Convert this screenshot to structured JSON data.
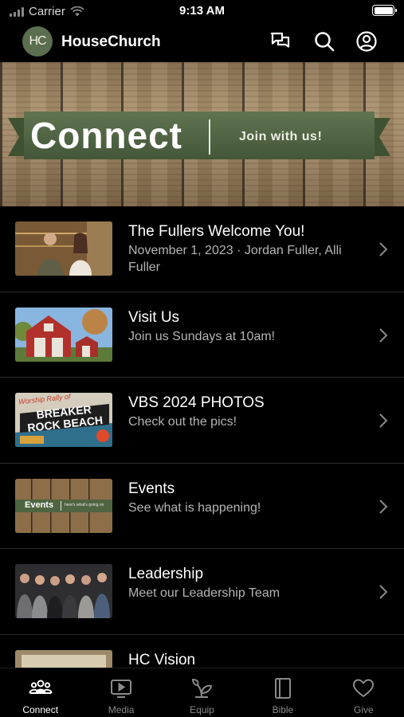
{
  "status_bar": {
    "carrier": "Carrier",
    "time": "9:13 AM"
  },
  "header": {
    "logo_text": "HC",
    "title": "HouseChurch",
    "icons": [
      "chat-icon",
      "search-icon",
      "profile-icon"
    ]
  },
  "hero": {
    "title": "Connect",
    "subtitle": "Join with us!",
    "banner_color": "#4f6441"
  },
  "items": [
    {
      "title": "The Fullers Welcome You!",
      "subtitle": "November 1, 2023 · Jordan Fuller, Alli Fuller"
    },
    {
      "title": "Visit Us",
      "subtitle": "Join us Sundays at 10am!"
    },
    {
      "title": "VBS 2024 PHOTOS",
      "subtitle": "Check out the pics!",
      "thumb_text_top": "Worship Rally of",
      "thumb_text_main": "BREAKER ROCK BEACH"
    },
    {
      "title": "Events",
      "subtitle": "See what is happening!",
      "thumb_text_main": "Events",
      "thumb_text_side": "here's what's going on"
    },
    {
      "title": "Leadership",
      "subtitle": "Meet our Leadership Team"
    },
    {
      "title": "HC Vision",
      "subtitle": ""
    }
  ],
  "tabbar": {
    "tabs": [
      {
        "label": "Connect",
        "icon": "people-icon",
        "active": true
      },
      {
        "label": "Media",
        "icon": "play-icon",
        "active": false
      },
      {
        "label": "Equip",
        "icon": "seedling-icon",
        "active": false
      },
      {
        "label": "Bible",
        "icon": "book-icon",
        "active": false
      },
      {
        "label": "Give",
        "icon": "heart-icon",
        "active": false
      }
    ]
  },
  "colors": {
    "background": "#000000",
    "logo_bg": "#5b6e4f",
    "secondary_text": "#b4b4b4"
  }
}
